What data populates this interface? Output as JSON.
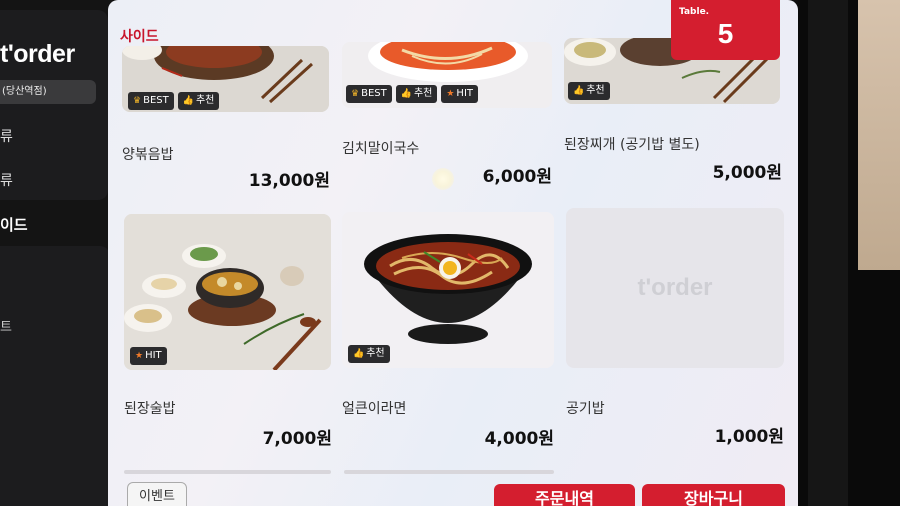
{
  "brand": {
    "logo_text": "t'order"
  },
  "sidebar": {
    "store_name": "(당산역점)",
    "items": [
      "류",
      "류"
    ],
    "active_category": "이드",
    "lower_items": [
      "",
      "",
      "트"
    ]
  },
  "section": {
    "title": "사이드"
  },
  "table": {
    "label": "Table.",
    "number": "5"
  },
  "menu": [
    {
      "name": "양볶음밥",
      "price": "13,000원",
      "badges": [
        {
          "icon": "crown-icon",
          "text": "BEST"
        },
        {
          "icon": "thumbs-up-icon",
          "text": "추천"
        }
      ]
    },
    {
      "name": "김치말이국수",
      "price": "6,000원",
      "badges": [
        {
          "icon": "crown-icon",
          "text": "BEST"
        },
        {
          "icon": "thumbs-up-icon",
          "text": "추천"
        },
        {
          "icon": "star-icon",
          "text": "HIT"
        }
      ]
    },
    {
      "name": "된장찌개 (공기밥 별도)",
      "price": "5,000원",
      "badges": [
        {
          "icon": "thumbs-up-icon",
          "text": "추천"
        }
      ]
    },
    {
      "name": "된장술밥",
      "price": "7,000원",
      "badges": [
        {
          "icon": "star-icon",
          "text": "HIT"
        }
      ]
    },
    {
      "name": "얼큰이라면",
      "price": "4,000원",
      "badges": [
        {
          "icon": "thumbs-up-icon",
          "text": "추천"
        }
      ]
    },
    {
      "name": "공기밥",
      "price": "1,000원",
      "badges": [],
      "placeholder_logo": "t'order"
    }
  ],
  "footer": {
    "event_label": "이벤트",
    "order_history_label": "주문내역",
    "cart_label": "장바구니"
  },
  "colors": {
    "accent": "#d41e2f",
    "badge_bg": "#2b2b2d",
    "sidebar_bg": "#1c1c1e"
  }
}
